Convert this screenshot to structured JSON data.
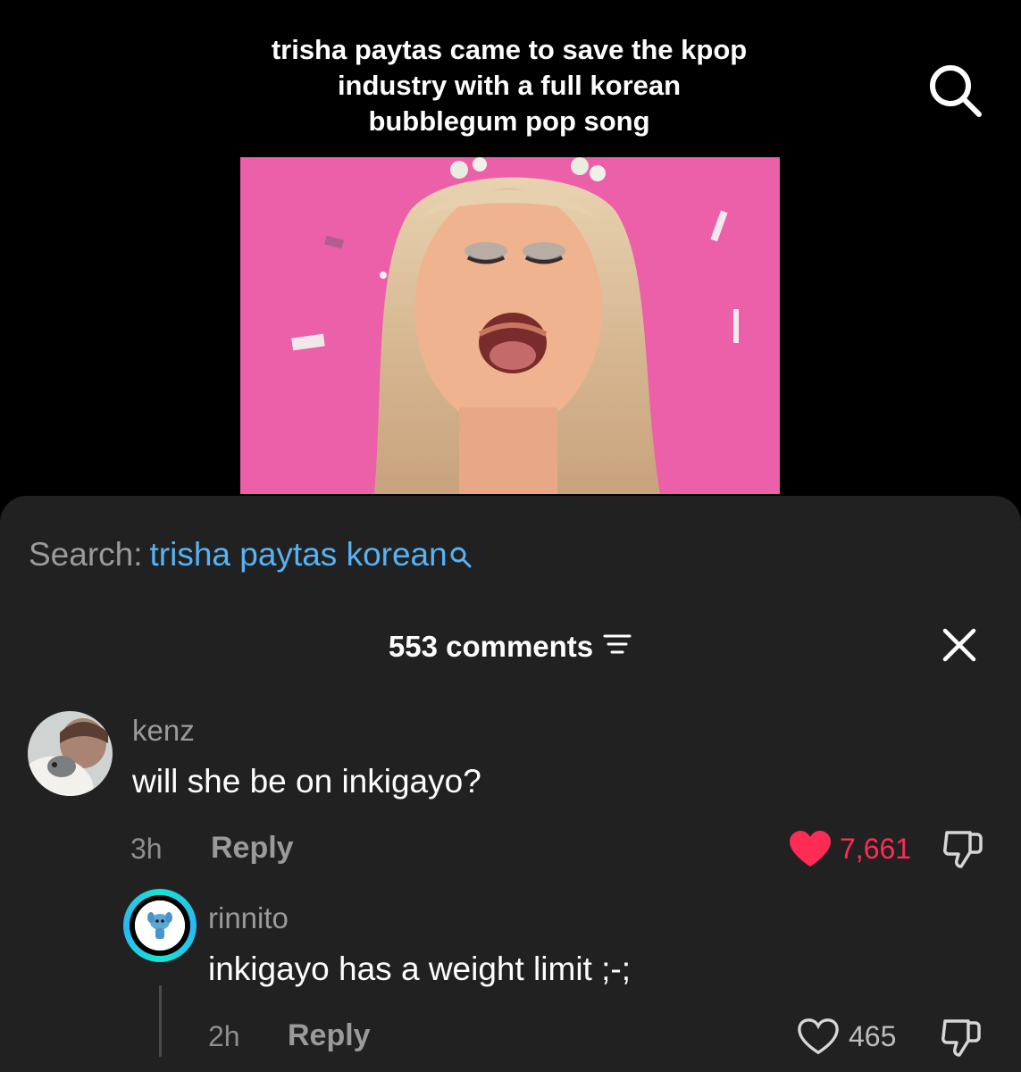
{
  "video": {
    "caption": "trisha paytas came to save the kpop industry with a full korean bubblegum pop song",
    "thumbnail_bg": "#ec5fa9"
  },
  "icons": {
    "top_search": "search-icon",
    "filter": "filter-icon",
    "close": "close-icon",
    "like_filled": "heart-filled-icon",
    "like_outline": "heart-outline-icon",
    "dislike": "thumbs-down-icon"
  },
  "search": {
    "label": "Search:",
    "query": "trisha paytas korean"
  },
  "comments": {
    "count_label": "553 comments",
    "items": [
      {
        "username": "kenz",
        "text": "will she be on inkigayo?",
        "time": "3h",
        "reply_label": "Reply",
        "likes": "7,661",
        "liked": true
      },
      {
        "username": "rinnito",
        "text": "inkigayo has a weight limit ;-;",
        "time": "2h",
        "reply_label": "Reply",
        "likes": "465",
        "liked": false
      }
    ]
  },
  "colors": {
    "link_blue": "#56b3f5",
    "like_red": "#fe2c55",
    "sheet_bg": "#212121",
    "avatar_ring": "#18e3d4"
  }
}
